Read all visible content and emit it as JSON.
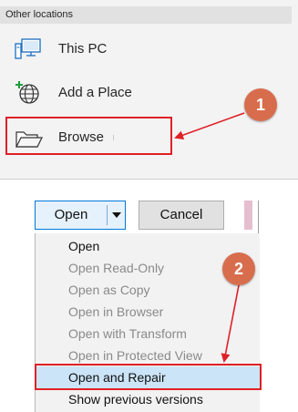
{
  "other_locations": {
    "header": "Other locations",
    "items": [
      {
        "label": "This PC",
        "icon": "computer-icon"
      },
      {
        "label": "Add a Place",
        "icon": "globe-add-icon"
      },
      {
        "label": "Browse",
        "icon": "folder-icon"
      }
    ]
  },
  "dialog": {
    "open_label": "Open",
    "cancel_label": "Cancel",
    "menu_items": [
      {
        "label": "Open",
        "enabled": true
      },
      {
        "label": "Open Read-Only",
        "enabled": false
      },
      {
        "label": "Open as Copy",
        "enabled": false
      },
      {
        "label": "Open in Browser",
        "enabled": false
      },
      {
        "label": "Open with Transform",
        "enabled": false
      },
      {
        "label": "Open in Protected View",
        "enabled": false
      },
      {
        "label": "Open and Repair",
        "enabled": true,
        "selected": true
      },
      {
        "label": "Show previous versions",
        "enabled": true
      }
    ]
  },
  "annotations": {
    "step1": "1",
    "step2": "2",
    "color": "#e02027",
    "badge_color": "#d86d4d"
  }
}
